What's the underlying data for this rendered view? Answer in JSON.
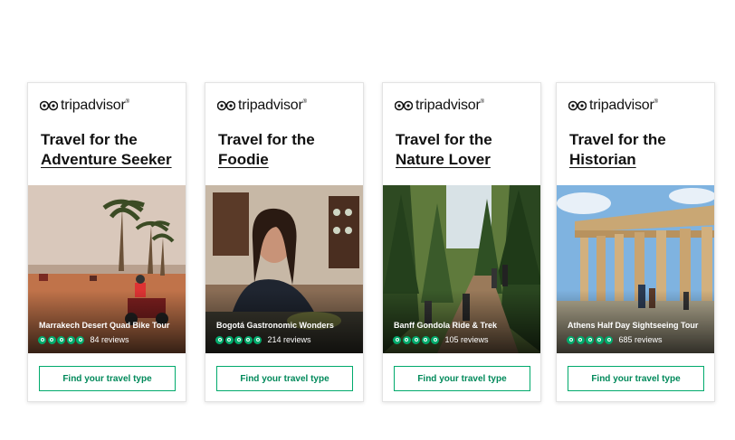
{
  "brand": {
    "name": "tripadvisor",
    "accent": "#00aa6c"
  },
  "cards": [
    {
      "line1": "Travel for the",
      "line2": "Adventure Seeker",
      "tour": "Marrakech Desert Quad Bike Tour",
      "rating": 5,
      "reviews": "84 reviews",
      "cta": "Find your travel type"
    },
    {
      "line1": "Travel for the",
      "line2": "Foodie",
      "tour": "Bogotá Gastronomic Wonders",
      "rating": 5,
      "reviews": "214 reviews",
      "cta": "Find your travel type"
    },
    {
      "line1": "Travel for the",
      "line2": "Nature Lover",
      "tour": "Banff Gondola Ride & Trek",
      "rating": 5,
      "reviews": "105 reviews",
      "cta": "Find your travel type"
    },
    {
      "line1": "Travel for the",
      "line2": "Historian",
      "tour": "Athens Half Day Sightseeing Tour",
      "rating": 5,
      "reviews": "685 reviews",
      "cta": "Find your travel type"
    }
  ]
}
